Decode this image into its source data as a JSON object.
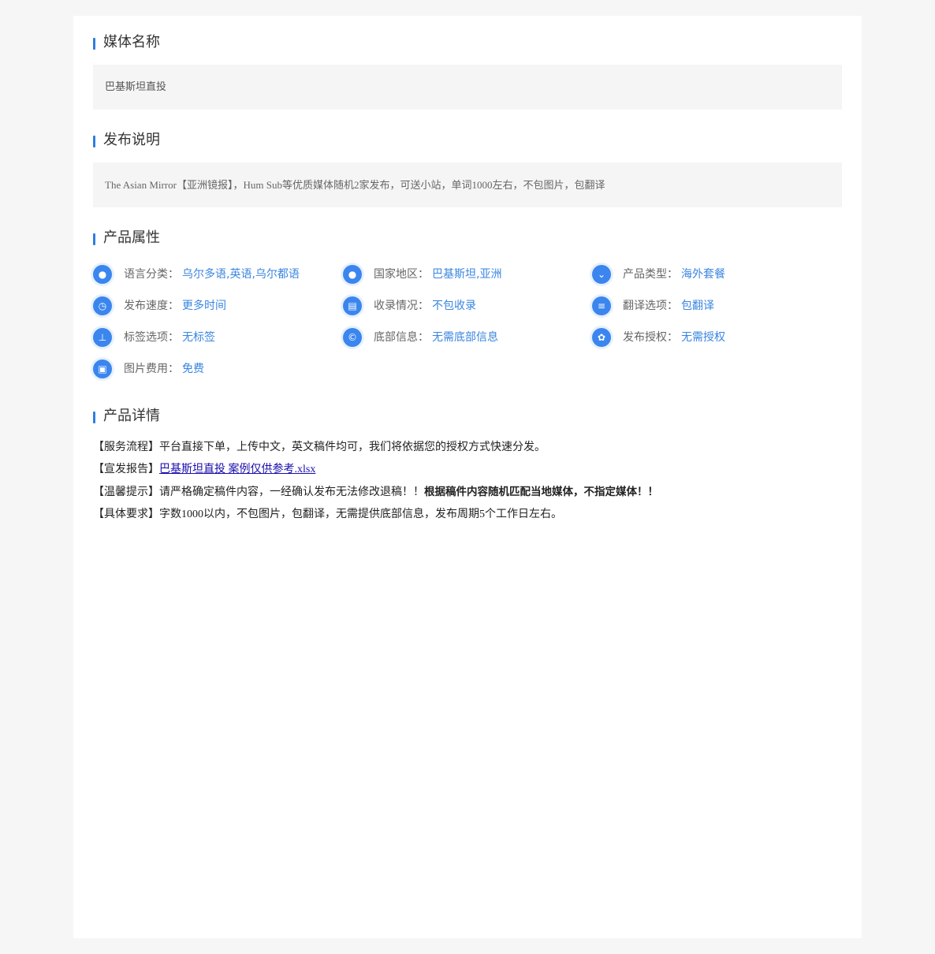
{
  "sections": {
    "media_name": {
      "title": "媒体名称",
      "value": "巴基斯坦直投"
    },
    "publish_notes": {
      "title": "发布说明",
      "value": "The Asian Mirror【亚洲镜报】，Hum Sub等优质媒体随机2家发布，可送小站，单词1000左右，不包图片，包翻译"
    },
    "attributes": {
      "title": "产品属性",
      "items": [
        {
          "icon": "globe-icon",
          "glyph": "●",
          "label": "语言分类：",
          "value": "乌尔多语,英语,乌尔都语"
        },
        {
          "icon": "globe-icon",
          "glyph": "●",
          "label": "国家地区：",
          "value": "巴基斯坦,亚洲"
        },
        {
          "icon": "chevron-down-icon",
          "glyph": "⌄",
          "label": "产品类型：",
          "value": "海外套餐"
        },
        {
          "icon": "clock-icon",
          "glyph": "◷",
          "label": "发布速度：",
          "value": "更多时间"
        },
        {
          "icon": "document-icon",
          "glyph": "▤",
          "label": "收录情况：",
          "value": "不包收录"
        },
        {
          "icon": "sliders-icon",
          "glyph": "≡",
          "label": "翻译选项：",
          "value": "包翻译"
        },
        {
          "icon": "sitemap-icon",
          "glyph": "⊥",
          "label": "标签选项：",
          "value": "无标签"
        },
        {
          "icon": "copyright-icon",
          "glyph": "©",
          "label": "底部信息：",
          "value": "无需底部信息"
        },
        {
          "icon": "paw-icon",
          "glyph": "✿",
          "label": "发布授权：",
          "value": "无需授权"
        },
        {
          "icon": "image-icon",
          "glyph": "▣",
          "label": "图片费用：",
          "value": "免费"
        }
      ]
    },
    "details": {
      "title": "产品详情",
      "service_flow": {
        "prefix": "【服务流程】",
        "text": "平台直接下单，上传中文，英文稿件均可，我们将依据您的授权方式快速分发。"
      },
      "report": {
        "prefix": "【宣发报告】",
        "link_text": "巴基斯坦直投 案例仅供参考.xlsx"
      },
      "tip": {
        "prefix": "【温馨提示】",
        "text": "请严格确定稿件内容，一经确认发布无法修改退稿！！",
        "bold": "根据稿件内容随机匹配当地媒体，不指定媒体！！"
      },
      "requirements": {
        "prefix": "【具体要求】",
        "text": "字数1000以内，不包图片，包翻译，无需提供底部信息，发布周期5个工作日左右。"
      }
    }
  },
  "colors": {
    "accent": "#2f7de1",
    "value_text": "#3a85e0",
    "icon_bg": "#3b86ee",
    "box_bg": "#f5f5f5"
  }
}
